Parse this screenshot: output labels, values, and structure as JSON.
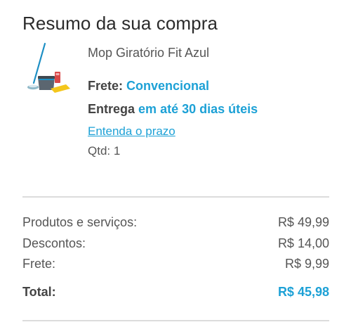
{
  "summary": {
    "title": "Resumo da sua compra"
  },
  "product": {
    "name": "Mop Giratório Fit Azul",
    "image_icon": "mop-bucket-icon",
    "shipping_label": "Frete:",
    "shipping_value": "Convencional",
    "delivery_label": "Entrega",
    "delivery_value": "em até 30 dias úteis",
    "deadline_link": "Entenda o prazo",
    "quantity": "Qtd: 1"
  },
  "totals": {
    "products_label": "Produtos e serviços:",
    "products_value": "R$ 49,99",
    "discounts_label": "Descontos:",
    "discounts_value": "R$ 14,00",
    "shipping_label": "Frete:",
    "shipping_value": "R$ 9,99",
    "total_label": "Total:",
    "total_value": "R$ 45,98"
  },
  "colors": {
    "accent": "#1da1d6",
    "divider": "#dcdcdc"
  }
}
